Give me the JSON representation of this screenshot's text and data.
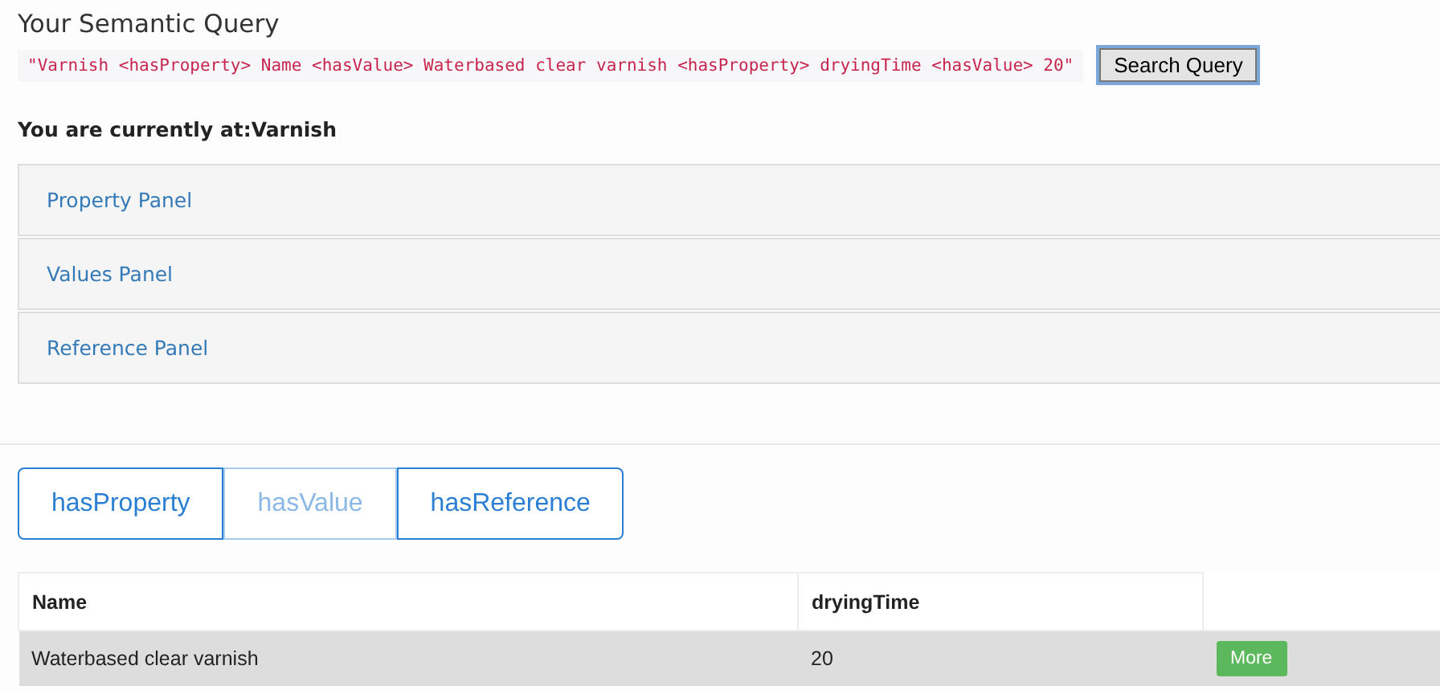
{
  "heading": "Your Semantic Query",
  "query": {
    "text": "\"Varnish <hasProperty> Name <hasValue> Waterbased clear varnish <hasProperty> dryingTime <hasValue> 20\"",
    "button": "Search Query"
  },
  "location": "You are currently at:Varnish",
  "panels": [
    {
      "label": "Property Panel"
    },
    {
      "label": "Values Panel"
    },
    {
      "label": "Reference Panel"
    }
  ],
  "buttons": [
    {
      "label": "hasProperty",
      "disabled": false
    },
    {
      "label": "hasValue",
      "disabled": true
    },
    {
      "label": "hasReference",
      "disabled": false
    }
  ],
  "table": {
    "columns": [
      "Name",
      "dryingTime"
    ],
    "rows": [
      {
        "cells": [
          "Waterbased clear varnish",
          "20"
        ],
        "action": "More"
      }
    ]
  }
}
